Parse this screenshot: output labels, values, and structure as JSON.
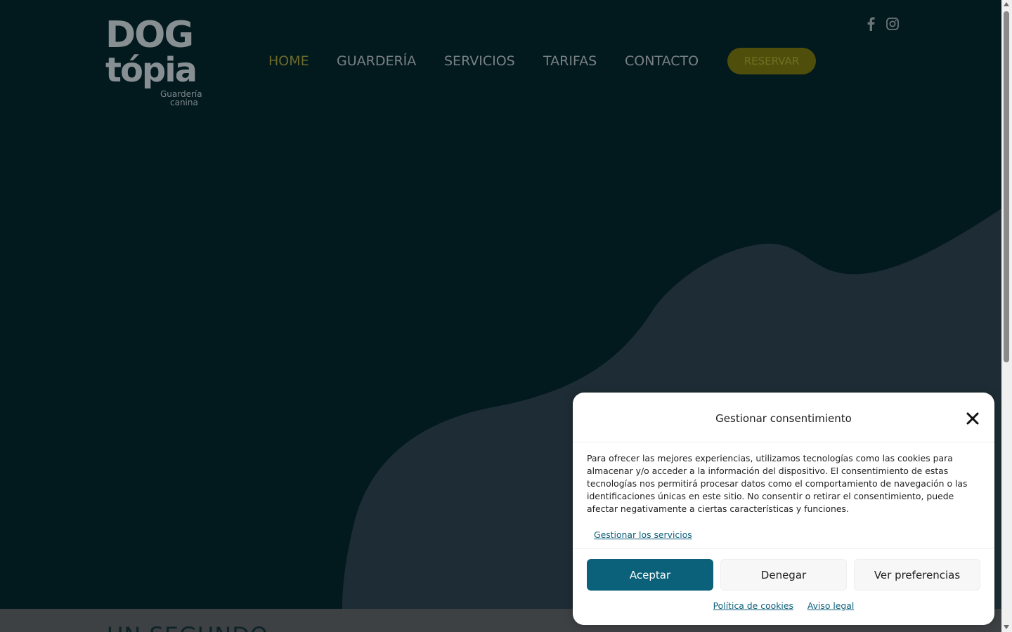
{
  "brand": {
    "logo_line1": "DOG",
    "logo_line2": "tópia",
    "tagline_line1": "Guardería",
    "tagline_line2": "canina"
  },
  "nav": {
    "items": [
      {
        "label": "HOME",
        "active": true
      },
      {
        "label": "GUARDERÍA",
        "active": false
      },
      {
        "label": "SERVICIOS",
        "active": false
      },
      {
        "label": "TARIFAS",
        "active": false
      },
      {
        "label": "CONTACTO",
        "active": false
      }
    ],
    "reserve_label": "RESERVAR"
  },
  "social": {
    "icons": [
      "facebook-icon",
      "instagram-icon"
    ]
  },
  "section": {
    "heading": "UN SEGUNDO"
  },
  "cookie_banner": {
    "title": "Gestionar consentimiento",
    "body": "Para ofrecer las mejores experiencias, utilizamos tecnologías como las cookies para almacenar y/o acceder a la información del dispositivo. El consentimiento de estas tecnologías nos permitirá procesar datos como el comportamiento de navegación o las identificaciones únicas en este sitio. No consentir o retirar el consentimiento, puede afectar negativamente a ciertas características y funciones.",
    "manage_services": "Gestionar los servicios",
    "accept_label": "Aceptar",
    "deny_label": "Denegar",
    "prefs_label": "Ver preferencias",
    "cookie_policy_link": "Política de cookies",
    "legal_notice_link": "Aviso legal"
  },
  "colors": {
    "hero_bg": "#05323d",
    "accent_yellow": "#9e9b16",
    "accept_button": "#0b6179"
  }
}
